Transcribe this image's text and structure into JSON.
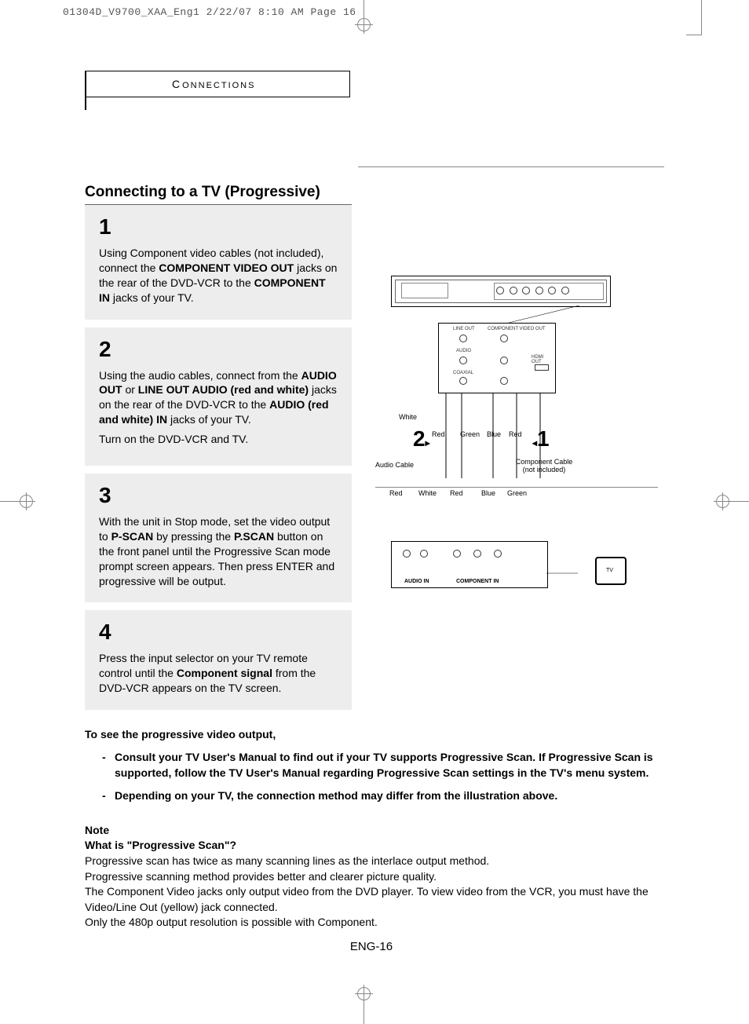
{
  "print_header": "01304D_V9700_XAA_Eng1  2/22/07  8:10 AM  Page 16",
  "section_label_first": "C",
  "section_label_rest": "ONNECTIONS",
  "title": "Connecting to a TV (Progressive)",
  "steps": [
    {
      "num": "1",
      "paragraphs": [
        "Using Component video cables (not included), connect the <b>COMPONENT VIDEO OUT</b> jacks on the rear of the DVD-VCR to the <b>COMPONENT IN</b> jacks of your TV."
      ]
    },
    {
      "num": "2",
      "paragraphs": [
        "Using the audio cables, connect from the <b>AUDIO OUT</b> or <b>LINE OUT AUDIO (red and white)</b>  jacks on the rear of the DVD-VCR to the <b>AUDIO (red and white) IN</b> jacks of your TV.",
        "Turn on the DVD-VCR and TV."
      ]
    },
    {
      "num": "3",
      "paragraphs": [
        "With the unit in Stop mode, set the video output to <b>P-SCAN</b> by pressing the <b>P.SCAN</b> button on the front panel until the Progressive Scan mode prompt screen appears. Then press ENTER and progressive will be output."
      ]
    },
    {
      "num": "4",
      "paragraphs": [
        "Press the input selector on your TV remote control until the <b>Component signal</b> from the DVD-VCR appears on the TV screen."
      ]
    }
  ],
  "diagram": {
    "panel_labels": {
      "line_out": "LINE OUT",
      "component_video_out": "COMPONENT VIDEO OUT",
      "audio": "AUDIO",
      "coaxial": "COAXIAL",
      "hdmi_out": "HDMI OUT"
    },
    "top_colors": {
      "white": "White",
      "red": "Red",
      "green": "Green",
      "blue": "Blue",
      "red2": "Red"
    },
    "big1": "1",
    "big2": "2",
    "audio_cable": "Audio Cable",
    "component_cable": "Component Cable",
    "not_included": "(not included)",
    "bottom_colors": {
      "red": "Red",
      "white": "White",
      "red2": "Red",
      "blue": "Blue",
      "green": "Green"
    },
    "audio_in": "AUDIO IN",
    "component_in": "COMPONENT IN",
    "tv": "TV"
  },
  "progressive_heading": "To see the progressive video output,",
  "bullets": [
    "Consult your TV User's Manual to find out if your TV supports Progressive Scan. If Progressive Scan is supported, follow the TV User's Manual regarding Progressive Scan settings in the TV's menu system.",
    "Depending on your TV, the connection method may differ from the illustration above."
  ],
  "note_label": "Note",
  "note_heading": "What is \"Progressive Scan\"?",
  "note_lines": [
    "Progressive scan has twice as many scanning lines as the interlace output method.",
    "Progressive scanning method provides better and clearer picture quality.",
    "The Component Video jacks only output video from the DVD player. To view video from the VCR, you must have the Video/Line Out (yellow) jack connected.",
    "Only the 480p output resolution is possible with Component."
  ],
  "page_num": "ENG-16"
}
